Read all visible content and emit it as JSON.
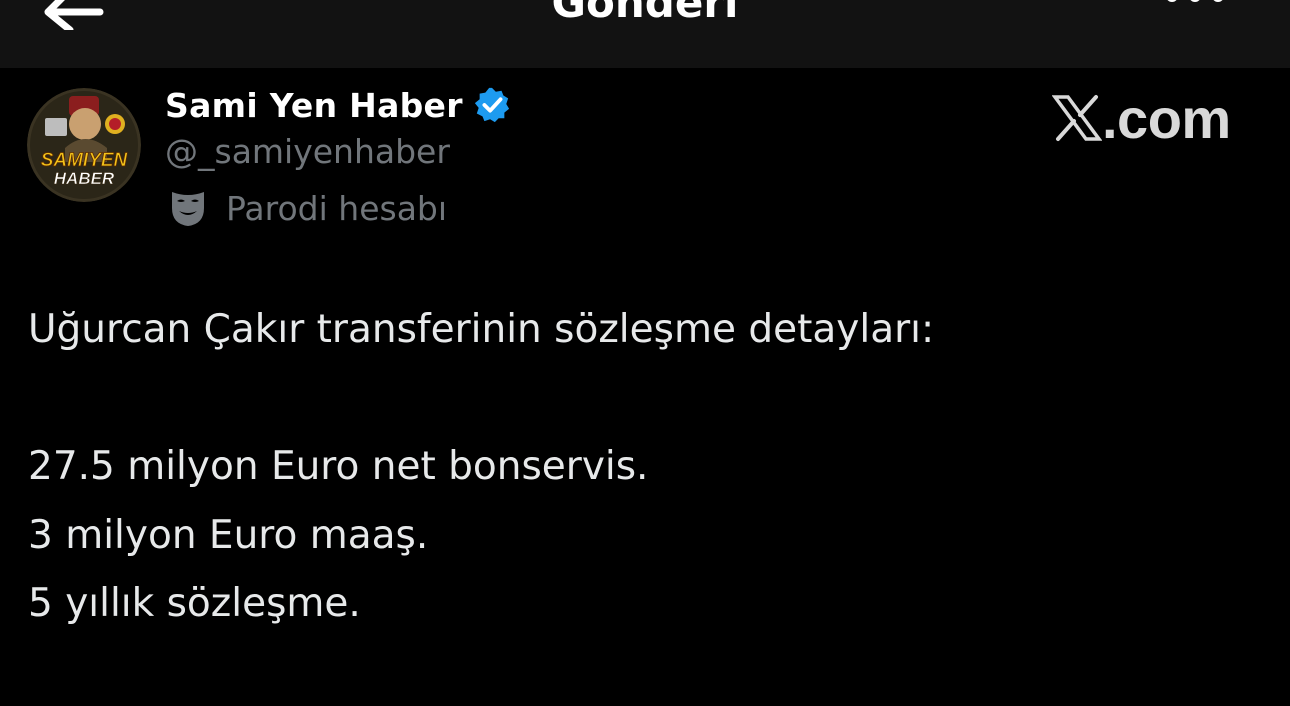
{
  "header": {
    "title": "Gönderi",
    "back_icon": "arrow-left-icon",
    "more_icon": "more-dots-icon"
  },
  "author": {
    "display_name": "Sami Yen Haber",
    "handle": "@_samiyenhaber",
    "verified_color": "#1d9bf0",
    "parody_label": "Parodi hesabı",
    "avatar_text_top": "SAMIYEN",
    "avatar_text_bottom": "HABER"
  },
  "brand": {
    "watermark": ".com"
  },
  "tweet": {
    "lines": [
      "Uğurcan Çakır transferinin sözleşme detayları:",
      "27.5 milyon Euro net bonservis.",
      "3 milyon Euro maaş.",
      "5 yıllık sözleşme."
    ]
  },
  "colors": {
    "background": "#000000",
    "header_bg": "#121212",
    "text_primary": "#e7e9ea",
    "text_secondary": "#71767b"
  }
}
